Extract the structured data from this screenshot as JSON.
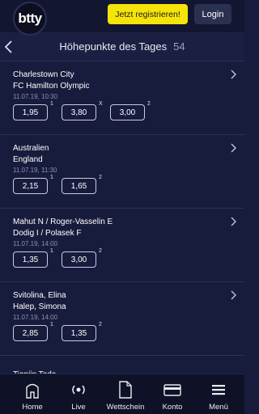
{
  "brand": {
    "logo_text": "btty"
  },
  "topbar": {
    "register_label": "Jetzt registrieren!",
    "login_label": "Login"
  },
  "header": {
    "title": "Höhepunkte des Tages",
    "count": "54"
  },
  "matches": [
    {
      "team1": "Charlestown City",
      "team2": "FC Hamilton Olympic",
      "datetime": "11.07.19, 10:30",
      "odds": [
        {
          "value": "1,95",
          "label": "1"
        },
        {
          "value": "3,80",
          "label": "X"
        },
        {
          "value": "3,00",
          "label": "2"
        }
      ]
    },
    {
      "team1": "Australien",
      "team2": "England",
      "datetime": "11.07.19, 11:30",
      "odds": [
        {
          "value": "2,15",
          "label": "1"
        },
        {
          "value": "1,65",
          "label": "2"
        }
      ]
    },
    {
      "team1": "Mahut N / Roger-Vasselin E",
      "team2": "Dodig I / Polasek F",
      "datetime": "11.07.19, 14:00",
      "odds": [
        {
          "value": "1,35",
          "label": "1"
        },
        {
          "value": "3,00",
          "label": "2"
        }
      ]
    },
    {
      "team1": "Svitolina, Elina",
      "team2": "Halep, Simona",
      "datetime": "11.07.19, 14:00",
      "odds": [
        {
          "value": "2,85",
          "label": "1"
        },
        {
          "value": "1,35",
          "label": "2"
        }
      ]
    }
  ],
  "next_match_teaser": "Tianjin Teda",
  "bottom_nav": [
    {
      "label": "Home",
      "icon": "home-icon"
    },
    {
      "label": "Live",
      "icon": "live-icon"
    },
    {
      "label": "Wettschein",
      "icon": "betslip-icon"
    },
    {
      "label": "Konto",
      "icon": "card-icon"
    },
    {
      "label": "Menü",
      "icon": "menu-icon"
    }
  ],
  "colors": {
    "background": "#171c3d",
    "accent_yellow": "#f5e40a",
    "muted_text": "#8b91b0"
  }
}
